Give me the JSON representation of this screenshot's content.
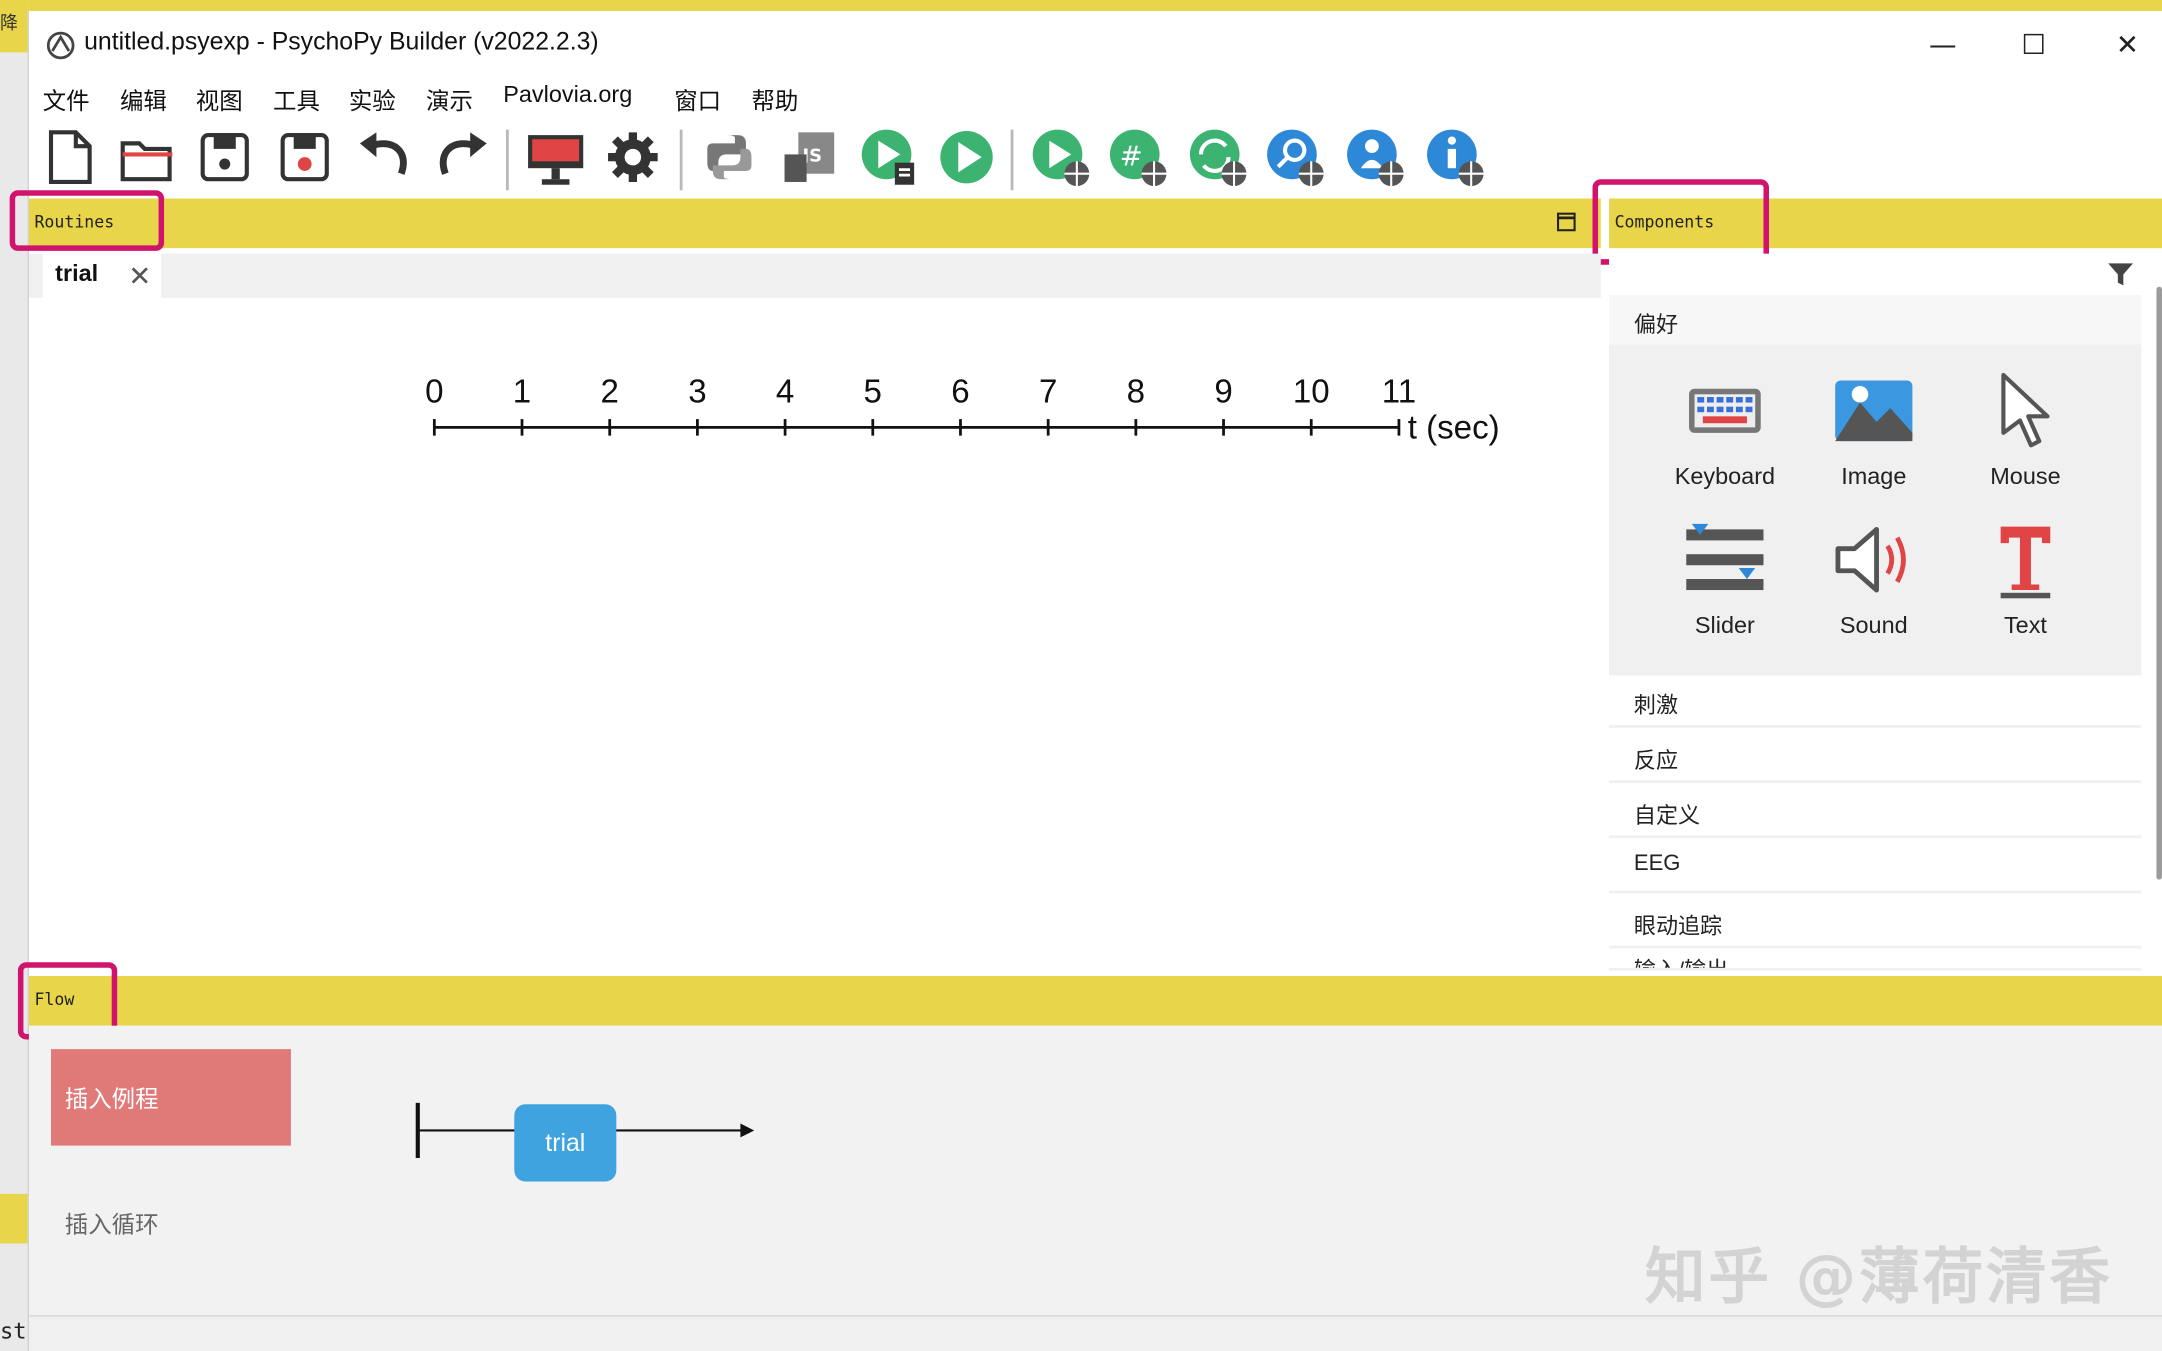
{
  "window": {
    "title": "untitled.psyexp - PsychoPy Builder (v2022.2.3)",
    "minimize": "—",
    "maximize": "☐",
    "close": "✕"
  },
  "background": {
    "left_char_top": "降",
    "left_char_bottom": "st"
  },
  "menu": [
    "文件",
    "编辑",
    "视图",
    "工具",
    "实验",
    "演示",
    "Pavlovia.org",
    "窗口",
    "帮助"
  ],
  "toolbar": {
    "icons": [
      "new-file-icon",
      "open-folder-icon",
      "save-icon",
      "save-as-icon",
      "undo-icon",
      "redo-icon",
      "monitor-icon",
      "settings-gear-icon",
      "python-icon",
      "javascript-icon",
      "run-local-log-icon",
      "run-icon",
      "run-online-icon",
      "pilot-online-icon",
      "sync-online-icon",
      "search-online-icon",
      "user-online-icon",
      "info-online-icon"
    ]
  },
  "routines": {
    "header": "Routines",
    "tab": "trial",
    "tab_close": "✕",
    "timeline_ticks": [
      "0",
      "1",
      "2",
      "3",
      "4",
      "5",
      "6",
      "7",
      "8",
      "9",
      "10",
      "11"
    ],
    "timeline_unit": "t (sec)"
  },
  "components": {
    "header": "Components",
    "favorites_label": "偏好",
    "favorites": [
      {
        "label": "Keyboard",
        "icon": "keyboard-icon"
      },
      {
        "label": "Image",
        "icon": "image-icon"
      },
      {
        "label": "Mouse",
        "icon": "mouse-cursor-icon"
      },
      {
        "label": "Slider",
        "icon": "slider-icon"
      },
      {
        "label": "Sound",
        "icon": "speaker-icon"
      },
      {
        "label": "Text",
        "icon": "text-t-icon"
      }
    ],
    "categories": [
      "刺激",
      "反应",
      "自定义",
      "EEG",
      "眼动追踪",
      "输入/输出"
    ]
  },
  "flow": {
    "header": "Flow",
    "insert_routine": "插入例程",
    "insert_loop": "插入循环",
    "routine_box": "trial"
  },
  "watermark": "知乎 @薄荷清香",
  "colors": {
    "panel_header": "#e8d54a",
    "highlight": "#d0136d",
    "insert_routine": "#e07a78",
    "flow_routine": "#3fa3e0",
    "run_green": "#3cb371"
  }
}
